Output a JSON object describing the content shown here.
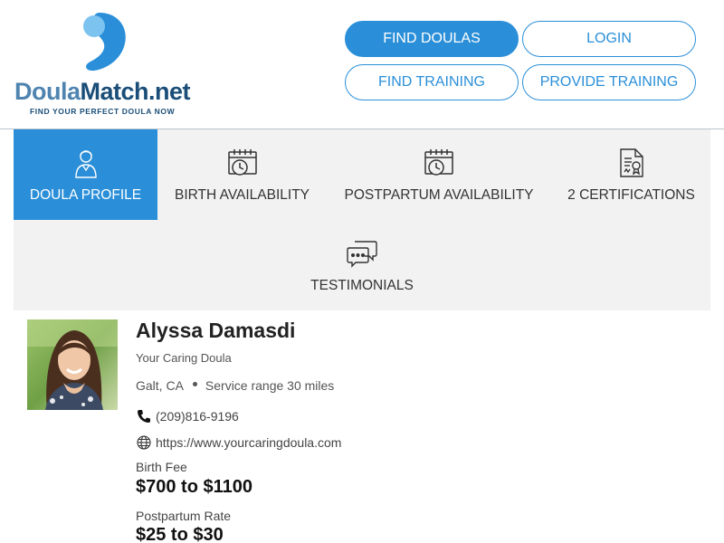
{
  "brand": {
    "name_part1": "Doula",
    "name_part2": "Match.net",
    "tagline": "FIND YOUR PERFECT DOULA NOW",
    "color_primary": "#2a8fd8",
    "color_dark": "#1a4e78"
  },
  "nav": {
    "find_doulas": "FIND DOULAS",
    "login": "LOGIN",
    "find_training": "FIND TRAINING",
    "provide_training": "PROVIDE TRAINING"
  },
  "tabs": [
    {
      "label": "DOULA PROFILE",
      "icon": "person-icon",
      "active": true
    },
    {
      "label": "BIRTH AVAILABILITY",
      "icon": "calendar-clock-icon",
      "active": false
    },
    {
      "label": "POSTPARTUM AVAILABILITY",
      "icon": "calendar-clock-icon",
      "active": false
    },
    {
      "label": "2 CERTIFICATIONS",
      "icon": "certificate-icon",
      "active": false
    },
    {
      "label": "TESTIMONIALS",
      "icon": "chat-bubbles-icon",
      "active": false
    }
  ],
  "profile": {
    "name": "Alyssa Damasdi",
    "business": "Your Caring Doula",
    "location": "Galt, CA",
    "service_range": "Service range 30 miles",
    "phone": "(209)816-9196",
    "website": "https://www.yourcaringdoula.com",
    "birth_fee_label": "Birth Fee",
    "birth_fee": "$700 to $1100",
    "postpartum_label": "Postpartum Rate",
    "postpartum_rate": "$25 to $30"
  }
}
